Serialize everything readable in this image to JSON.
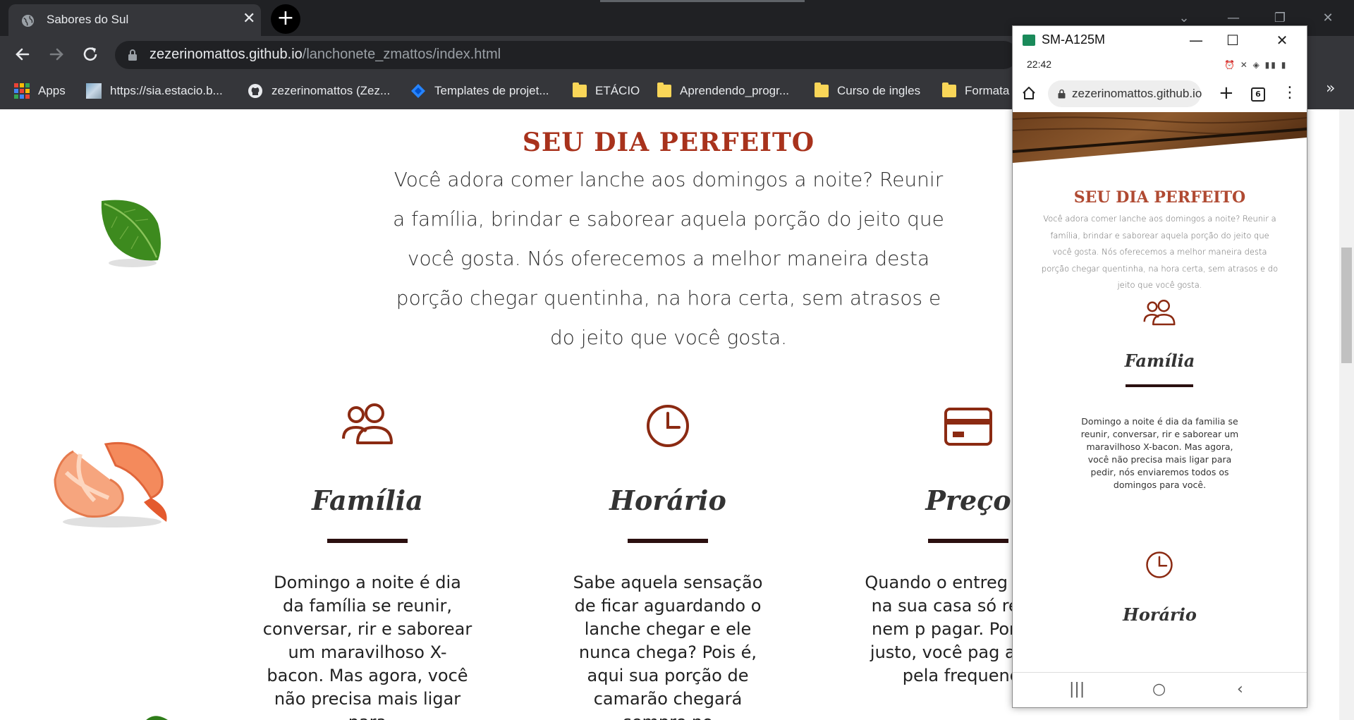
{
  "browser": {
    "tab_title": "Sabores do Sul",
    "tab_close": "✕",
    "new_tab": "+",
    "url_host": "zezerinomattos.github.io",
    "url_path": "/lanchonete_zmattos/index.html",
    "bookmarks": [
      {
        "label": "Apps",
        "icon": "apps-grid-icon"
      },
      {
        "label": "https://sia.estacio.b...",
        "icon": "site-icon"
      },
      {
        "label": "zezerinomattos (Zez...",
        "icon": "github-icon"
      },
      {
        "label": "Templates de projet...",
        "icon": "diamond-icon"
      },
      {
        "label": "ETÁCIO",
        "icon": "folder-icon"
      },
      {
        "label": "Aprendendo_progr...",
        "icon": "folder-icon"
      },
      {
        "label": "Curso de ingles",
        "icon": "folder-icon"
      },
      {
        "label": "Formata",
        "icon": "folder-icon"
      }
    ],
    "bookmarks_more": "»"
  },
  "page": {
    "title": "SEU DIA PERFEITO",
    "intro": "Você adora comer lanche aos domingos a noite? Reunir a família, brindar e saborear aquela porção do jeito que você gosta. Nós oferecemos a melhor maneira desta porção chegar quentinha, na hora certa, sem atrasos e do jeito que você gosta.",
    "features": [
      {
        "icon": "family-icon",
        "title": "Família",
        "text": "Domingo a noite é dia da família se reunir, conversar, rir e saborear um maravilhoso X-bacon. Mas agora, você não precisa mais ligar para"
      },
      {
        "icon": "clock-icon",
        "title": "Horário",
        "text": "Sabe aquela sensação de ficar aguardando o lanche chegar e ele nunca chega? Pois é, aqui sua porção de camarão chegará sempre no"
      },
      {
        "icon": "credit-card-icon",
        "title": "Preço",
        "text": "Quando o entreg chegar na sua casa só recebe, nem p pagar. Por um p justo, você pag apenas pela frequencia"
      }
    ]
  },
  "phone": {
    "device_name": "SM-A125M",
    "time": "22:42",
    "url": "zezerinomattos.github.io",
    "tab_count": "6",
    "title": "SEU DIA PERFEITO",
    "intro": "Você adora comer lanche aos domingos a noite? Reunir a família, brindar e saborear aquela porção do jeito que você gosta. Nós oferecemos a melhor maneira desta porção chegar quentinha, na hora certa, sem atrasos e do jeito que você gosta.",
    "feature1_title": "Família",
    "feature1_text": "Domingo a noite é dia da familia se reunir, conversar, rir e saborear um maravilhoso X-bacon. Mas agora, você não precisa mais ligar para pedir, nós enviaremos todos os domingos para você.",
    "feature2_title": "Horário"
  },
  "colors": {
    "accent": "#a8321c",
    "icon": "#8b2a12",
    "bar": "#2b1010",
    "chrome_dark": "#202124",
    "chrome": "#35363a"
  }
}
